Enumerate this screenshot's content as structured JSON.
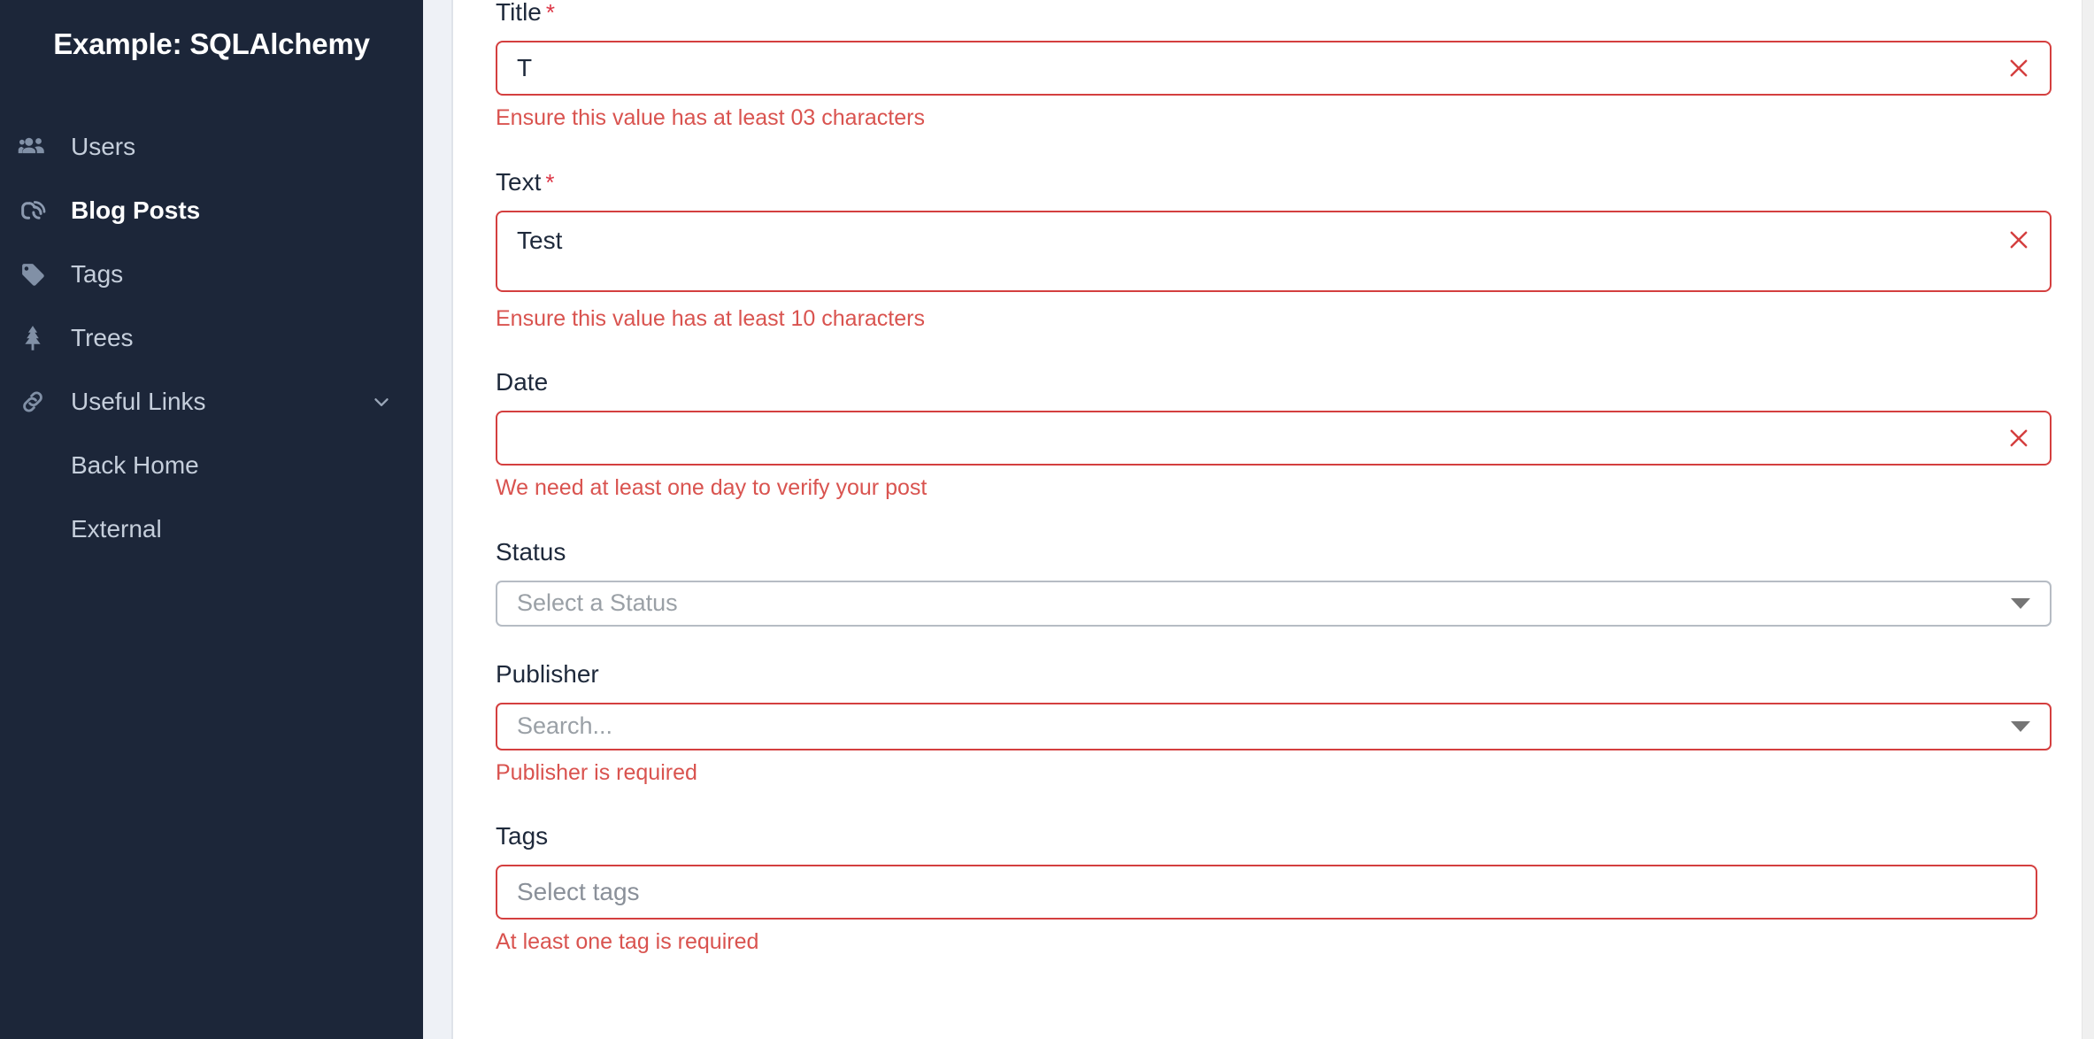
{
  "sidebar": {
    "brand_title": "Example: SQLAlchemy",
    "items": [
      {
        "label": "Users",
        "icon": "users-group-icon",
        "active": false
      },
      {
        "label": "Blog Posts",
        "icon": "blogger-b-icon",
        "active": true
      },
      {
        "label": "Tags",
        "icon": "tag-icon",
        "active": false
      },
      {
        "label": "Trees",
        "icon": "pine-tree-icon",
        "active": false
      },
      {
        "label": "Useful Links",
        "icon": "link-chain-icon",
        "active": false,
        "expandable": true
      }
    ],
    "sub_items": [
      {
        "label": "Back Home"
      },
      {
        "label": "External"
      }
    ]
  },
  "form": {
    "title": {
      "label": "Title",
      "required_marker": "*",
      "value": "T",
      "error": "Ensure this value has at least 03 characters"
    },
    "text": {
      "label": "Text",
      "required_marker": "*",
      "value": "Test",
      "error": "Ensure this value has at least 10 characters"
    },
    "date": {
      "label": "Date",
      "value": "",
      "error": "We need at least one day to verify your post"
    },
    "status": {
      "label": "Status",
      "placeholder": "Select a Status",
      "value": ""
    },
    "publisher": {
      "label": "Publisher",
      "placeholder": "Search...",
      "value": "",
      "error": "Publisher is required"
    },
    "tags": {
      "label": "Tags",
      "placeholder": "Select tags",
      "value": "",
      "error": "At least one tag is required"
    }
  },
  "colors": {
    "sidebar_bg": "#1c2639",
    "error_red": "#d9534f",
    "border_red": "#d43f3f",
    "label_text": "#1e293b",
    "muted_text": "#9aa0a6"
  }
}
